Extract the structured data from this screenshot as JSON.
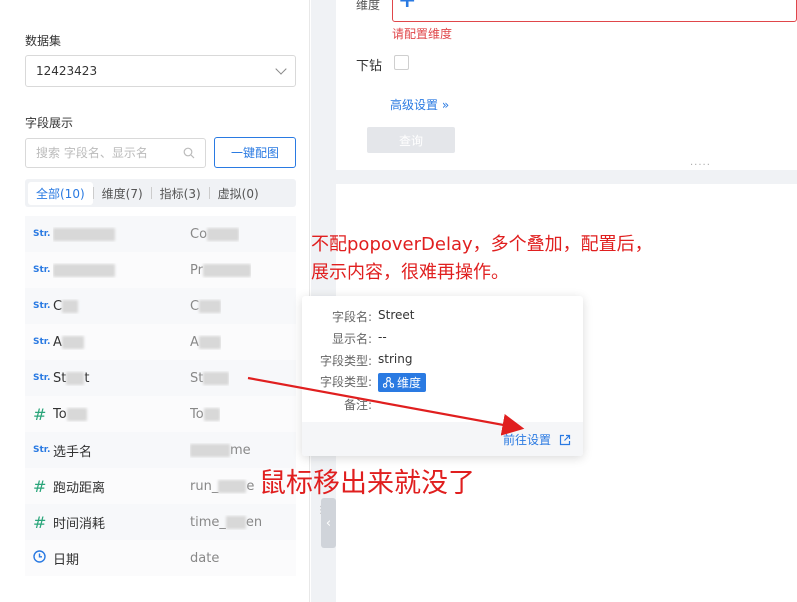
{
  "left_panel": {
    "dataset_label": "数据集",
    "dataset_value": "12423423",
    "fields_label": "字段展示",
    "search_placeholder": "搜索 字段名、显示名",
    "auto_button": "一键配图",
    "tabs": [
      {
        "label": "全部(10)",
        "active": true
      },
      {
        "label": "维度(7)",
        "active": false
      },
      {
        "label": "指标(3)",
        "active": false
      },
      {
        "label": "虚拟(0)",
        "active": false
      }
    ],
    "fields": [
      {
        "type": "Str.",
        "name_prefix": "",
        "alias_prefix": "Co"
      },
      {
        "type": "Str.",
        "name_prefix": "",
        "alias_prefix": "Pr"
      },
      {
        "type": "Str.",
        "name_prefix": "C",
        "alias_prefix": "C"
      },
      {
        "type": "Str.",
        "name_prefix": "A",
        "alias_prefix": "A"
      },
      {
        "type": "Str.",
        "name_prefix": "St",
        "name_suffix": "t",
        "alias_prefix": "St"
      },
      {
        "type": "#",
        "name_prefix": "To",
        "alias_prefix": "To"
      },
      {
        "type": "Str.",
        "name_prefix": "选手名",
        "alias_prefix": "",
        "alias_suffix": "me"
      },
      {
        "type": "#",
        "name_prefix": "跑动距离",
        "alias_prefix": "run_",
        "alias_suffix": "e"
      },
      {
        "type": "#",
        "name_prefix": "时间消耗",
        "alias_prefix": "time_",
        "alias_suffix": "en"
      },
      {
        "type": "date",
        "name_prefix": "日期",
        "alias_prefix": "date"
      }
    ]
  },
  "config": {
    "dimension_label": "维度",
    "dimension_error": "请配置维度",
    "drill_label": "下钻",
    "advanced_label": "高级设置",
    "query_button": "查询"
  },
  "popover": {
    "rows": [
      {
        "key": "字段名:",
        "value": "Street"
      },
      {
        "key": "显示名:",
        "value": "--"
      },
      {
        "key": "字段类型:",
        "value": "string"
      },
      {
        "key": "字段类型:",
        "value": "维度"
      },
      {
        "key": "备注:",
        "value": ""
      }
    ],
    "link": "前往设置"
  },
  "annotations": {
    "note1_line1": "不配popoverDelay，多个叠加，配置后，",
    "note1_line2": "展示内容，很难再操作。",
    "note2": "鼠标移出来就没了"
  },
  "colors": {
    "accent": "#2a7ae2",
    "error": "#e0464a",
    "annotation": "#e01f1f"
  }
}
